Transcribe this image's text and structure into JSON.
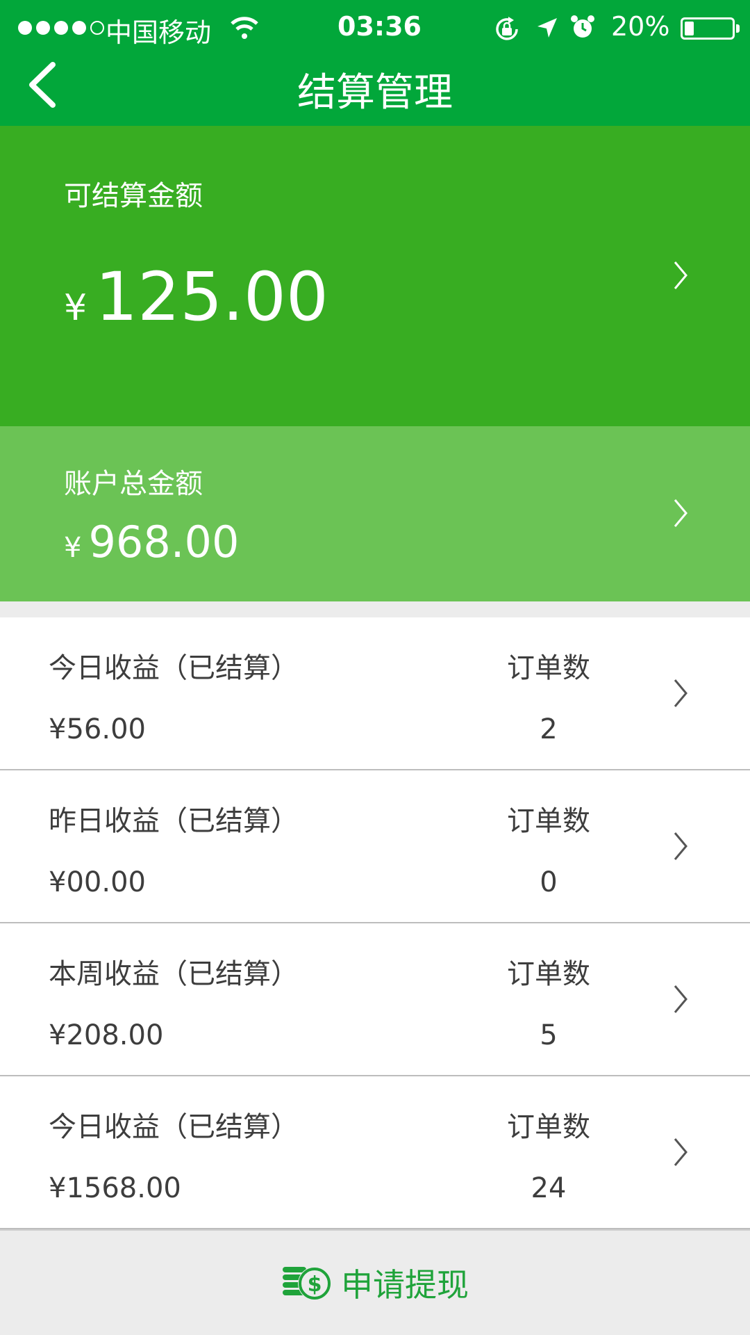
{
  "status_bar": {
    "carrier": "中国移动",
    "time": "03:36",
    "battery_percent": "20%",
    "battery_level": 0.2
  },
  "header": {
    "title": "结算管理",
    "back_icon": "chevron-left-icon"
  },
  "settle": {
    "label": "可结算金额",
    "currency": "¥",
    "amount": "125.00"
  },
  "total": {
    "label": "账户总金额",
    "currency": "¥",
    "amount": "968.00"
  },
  "stats": [
    {
      "title": "今日收益（已结算）",
      "amount": "¥56.00",
      "orders_label": "订单数",
      "orders": "2"
    },
    {
      "title": "昨日收益（已结算）",
      "amount": "¥00.00",
      "orders_label": "订单数",
      "orders": "0"
    },
    {
      "title": "本周收益（已结算）",
      "amount": "¥208.00",
      "orders_label": "订单数",
      "orders": "5"
    },
    {
      "title": "今日收益（已结算）",
      "amount": "¥1568.00",
      "orders_label": "订单数",
      "orders": "24"
    }
  ],
  "withdraw": {
    "label": "申请提现",
    "icon": "coins-dollar-icon"
  },
  "colors": {
    "header_green": "#02a73a",
    "settle_green": "#38ad22",
    "total_green": "#6bc355",
    "button_text_green": "#1fa33a"
  }
}
